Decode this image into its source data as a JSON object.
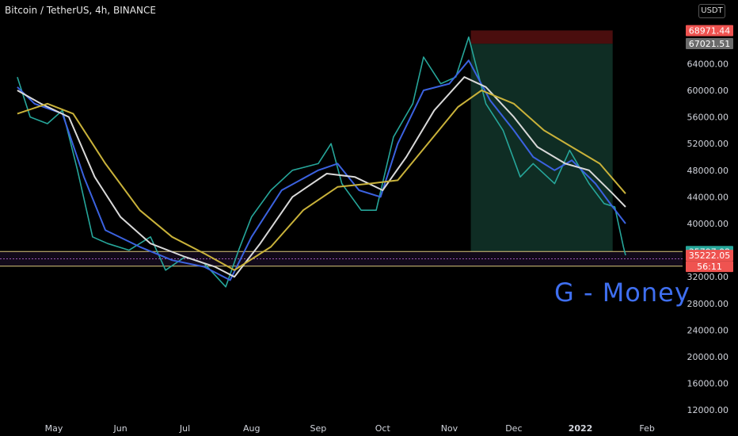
{
  "header": {
    "title": "Bitcoin / TetherUS, 4h, BINANCE",
    "currency_label": "USDT"
  },
  "watermark": "G - Money",
  "colors": {
    "background": "#000000",
    "text": "#d1d4dc",
    "up": "#26a69a",
    "down": "#ef5350",
    "ema_fast": "#3b62e0",
    "ema_mid": "#d9d9d9",
    "ema_slow": "#c9b23a",
    "zone": "#0f2d24",
    "zone_top": "#4a0e0e",
    "band_line": "#d9c87a",
    "band_mid": "#9b59b6"
  },
  "chart_data": {
    "type": "line",
    "title": "Bitcoin / TetherUS, 4h, BINANCE",
    "xlabel": "",
    "ylabel": "",
    "ylim": [
      10000,
      70000
    ],
    "y_scale": "linear",
    "y_ticks": [
      "64000.00",
      "60000.00",
      "56000.00",
      "52000.00",
      "48000.00",
      "44000.00",
      "40000.00",
      "32000.00",
      "28000.00",
      "24000.00",
      "20000.00",
      "16000.00",
      "12000.00"
    ],
    "x_ticks": [
      "May",
      "Jun",
      "Jul",
      "Aug",
      "Sep",
      "Oct",
      "Nov",
      "Dec",
      "2022",
      "Feb"
    ],
    "grid": false,
    "price_labels": [
      {
        "value": "68971.44",
        "color": "#ef5350"
      },
      {
        "value": "67021.51",
        "color": "#6b6b6b"
      },
      {
        "value": "35797.92",
        "color": "#26a69a"
      },
      {
        "value": "35222.05",
        "color": "#ef5350"
      },
      {
        "value": "56:11",
        "color": "#ef5350"
      }
    ],
    "levels": {
      "band_top": 35800,
      "band_bottom": 33600,
      "band_mid": 34700,
      "zone_top": 67000,
      "zone_stop": 69000
    },
    "series": [
      {
        "color": "#26a69a",
        "points": [
          [
            "2021-04-14",
            62000
          ],
          [
            "2021-04-20",
            56000
          ],
          [
            "2021-04-28",
            55000
          ],
          [
            "2021-05-05",
            57000
          ],
          [
            "2021-05-12",
            48000
          ],
          [
            "2021-05-19",
            38000
          ],
          [
            "2021-05-26",
            37000
          ],
          [
            "2021-06-05",
            36000
          ],
          [
            "2021-06-15",
            38000
          ],
          [
            "2021-06-22",
            33000
          ],
          [
            "2021-07-01",
            35000
          ],
          [
            "2021-07-10",
            34000
          ],
          [
            "2021-07-20",
            30500
          ],
          [
            "2021-07-26",
            36000
          ],
          [
            "2021-08-01",
            41000
          ],
          [
            "2021-08-10",
            45000
          ],
          [
            "2021-08-20",
            48000
          ],
          [
            "2021-09-01",
            49000
          ],
          [
            "2021-09-07",
            52000
          ],
          [
            "2021-09-12",
            46000
          ],
          [
            "2021-09-21",
            42000
          ],
          [
            "2021-09-28",
            42000
          ],
          [
            "2021-10-06",
            53000
          ],
          [
            "2021-10-15",
            58000
          ],
          [
            "2021-10-20",
            65000
          ],
          [
            "2021-10-28",
            61000
          ],
          [
            "2021-11-04",
            62000
          ],
          [
            "2021-11-10",
            68000
          ],
          [
            "2021-11-18",
            58000
          ],
          [
            "2021-11-26",
            54000
          ],
          [
            "2021-12-04",
            47000
          ],
          [
            "2021-12-10",
            49000
          ],
          [
            "2021-12-20",
            46000
          ],
          [
            "2021-12-27",
            51000
          ],
          [
            "2022-01-05",
            46000
          ],
          [
            "2022-01-12",
            43000
          ],
          [
            "2022-01-17",
            42500
          ],
          [
            "2022-01-21",
            36500
          ],
          [
            "2022-01-22",
            35222
          ]
        ]
      },
      {
        "color": "#3b62e0",
        "points": [
          [
            "2021-04-14",
            60500
          ],
          [
            "2021-04-22",
            58000
          ],
          [
            "2021-05-05",
            56500
          ],
          [
            "2021-05-15",
            47000
          ],
          [
            "2021-05-25",
            39000
          ],
          [
            "2021-06-10",
            36500
          ],
          [
            "2021-06-25",
            34500
          ],
          [
            "2021-07-10",
            33500
          ],
          [
            "2021-07-22",
            31500
          ],
          [
            "2021-08-01",
            38000
          ],
          [
            "2021-08-15",
            45000
          ],
          [
            "2021-09-01",
            48000
          ],
          [
            "2021-09-10",
            49000
          ],
          [
            "2021-09-20",
            45000
          ],
          [
            "2021-09-30",
            44000
          ],
          [
            "2021-10-08",
            52000
          ],
          [
            "2021-10-20",
            60000
          ],
          [
            "2021-11-01",
            61000
          ],
          [
            "2021-11-10",
            64500
          ],
          [
            "2021-11-20",
            58500
          ],
          [
            "2021-12-01",
            54000
          ],
          [
            "2021-12-10",
            50000
          ],
          [
            "2021-12-20",
            48000
          ],
          [
            "2021-12-28",
            49500
          ],
          [
            "2022-01-08",
            46000
          ],
          [
            "2022-01-16",
            42500
          ],
          [
            "2022-01-22",
            40000
          ]
        ]
      },
      {
        "color": "#d9d9d9",
        "points": [
          [
            "2021-04-14",
            60000
          ],
          [
            "2021-04-25",
            58000
          ],
          [
            "2021-05-08",
            56000
          ],
          [
            "2021-05-20",
            47000
          ],
          [
            "2021-06-01",
            41000
          ],
          [
            "2021-06-15",
            37000
          ],
          [
            "2021-07-01",
            35000
          ],
          [
            "2021-07-15",
            33500
          ],
          [
            "2021-07-24",
            32000
          ],
          [
            "2021-08-05",
            37000
          ],
          [
            "2021-08-20",
            44000
          ],
          [
            "2021-09-05",
            47500
          ],
          [
            "2021-09-18",
            47000
          ],
          [
            "2021-10-01",
            45000
          ],
          [
            "2021-10-12",
            50000
          ],
          [
            "2021-10-25",
            57000
          ],
          [
            "2021-11-08",
            62000
          ],
          [
            "2021-11-18",
            60500
          ],
          [
            "2021-12-01",
            56000
          ],
          [
            "2021-12-12",
            51500
          ],
          [
            "2021-12-25",
            49000
          ],
          [
            "2022-01-05",
            48000
          ],
          [
            "2022-01-16",
            44500
          ],
          [
            "2022-01-22",
            42500
          ]
        ]
      },
      {
        "color": "#c9b23a",
        "points": [
          [
            "2021-04-14",
            56500
          ],
          [
            "2021-04-28",
            58000
          ],
          [
            "2021-05-10",
            56500
          ],
          [
            "2021-05-25",
            49000
          ],
          [
            "2021-06-10",
            42000
          ],
          [
            "2021-06-25",
            38000
          ],
          [
            "2021-07-10",
            35500
          ],
          [
            "2021-07-24",
            33000
          ],
          [
            "2021-08-10",
            36500
          ],
          [
            "2021-08-25",
            42000
          ],
          [
            "2021-09-10",
            45500
          ],
          [
            "2021-09-25",
            46000
          ],
          [
            "2021-10-08",
            46500
          ],
          [
            "2021-10-22",
            52000
          ],
          [
            "2021-11-05",
            57500
          ],
          [
            "2021-11-16",
            60000
          ],
          [
            "2021-12-01",
            58000
          ],
          [
            "2021-12-15",
            54000
          ],
          [
            "2021-12-28",
            51500
          ],
          [
            "2022-01-10",
            49000
          ],
          [
            "2022-01-22",
            44500
          ]
        ]
      }
    ]
  }
}
